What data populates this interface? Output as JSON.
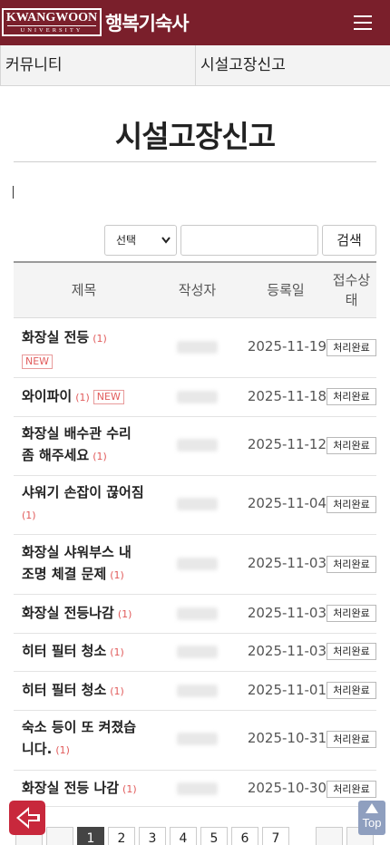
{
  "header": {
    "logo_main": "KWANGWOON",
    "logo_sub": "UNIVERSITY",
    "title": "행복기숙사",
    "brand_color": "#7a1f2b"
  },
  "subnav": {
    "items": [
      {
        "label": "커뮤니티"
      },
      {
        "label": "시설고장신고"
      }
    ]
  },
  "page": {
    "title": "시설고장신고"
  },
  "search": {
    "select_value": "선택",
    "input_value": "",
    "button_label": "검색"
  },
  "table": {
    "headers": {
      "title": "제목",
      "author": "작성자",
      "date": "등록일",
      "status_line1": "접수상",
      "status_line2": "태"
    },
    "rows": [
      {
        "title": "화장실 전등",
        "count": "(1)",
        "new": "NEW",
        "date": "2025-11-19",
        "status": "처리완료"
      },
      {
        "title": "와이파이",
        "count": "(1)",
        "new": "NEW",
        "date": "2025-11-18",
        "status": "처리완료"
      },
      {
        "title_line1": "화장실 배수관 수리",
        "title_line2": "좀 해주세요",
        "count": "(1)",
        "date": "2025-11-12",
        "status": "처리완료"
      },
      {
        "title": "샤워기 손잡이 끊어짐",
        "count": "(1)",
        "date": "2025-11-04",
        "status": "처리완료"
      },
      {
        "title_line1": "화장실 샤워부스 내",
        "title_line2": "조명 체결 문제",
        "count": "(1)",
        "date": "2025-11-03",
        "status": "처리완료"
      },
      {
        "title": "화장실 전등나감",
        "count": "(1)",
        "date": "2025-11-03",
        "status": "처리완료"
      },
      {
        "title": "히터 필터 청소",
        "count": "(1)",
        "date": "2025-11-03",
        "status": "처리완료"
      },
      {
        "title": "히터 필터 청소",
        "count": "(1)",
        "date": "2025-11-01",
        "status": "처리완료"
      },
      {
        "title_line1": "숙소 등이 또 켜졌습",
        "title_line2": "니다.",
        "count": "(1)",
        "date": "2025-10-31",
        "status": "처리완료"
      },
      {
        "title": "화장실 전등 나감",
        "count": "(1)",
        "date": "2025-10-30",
        "status": "처리완료"
      }
    ]
  },
  "pagination": {
    "pages": [
      "1",
      "2",
      "3",
      "4",
      "5",
      "6",
      "7"
    ],
    "current": "1"
  },
  "floating": {
    "top_label": "Top",
    "back_color": "#c8283c",
    "top_color": "#8f9fbf"
  }
}
